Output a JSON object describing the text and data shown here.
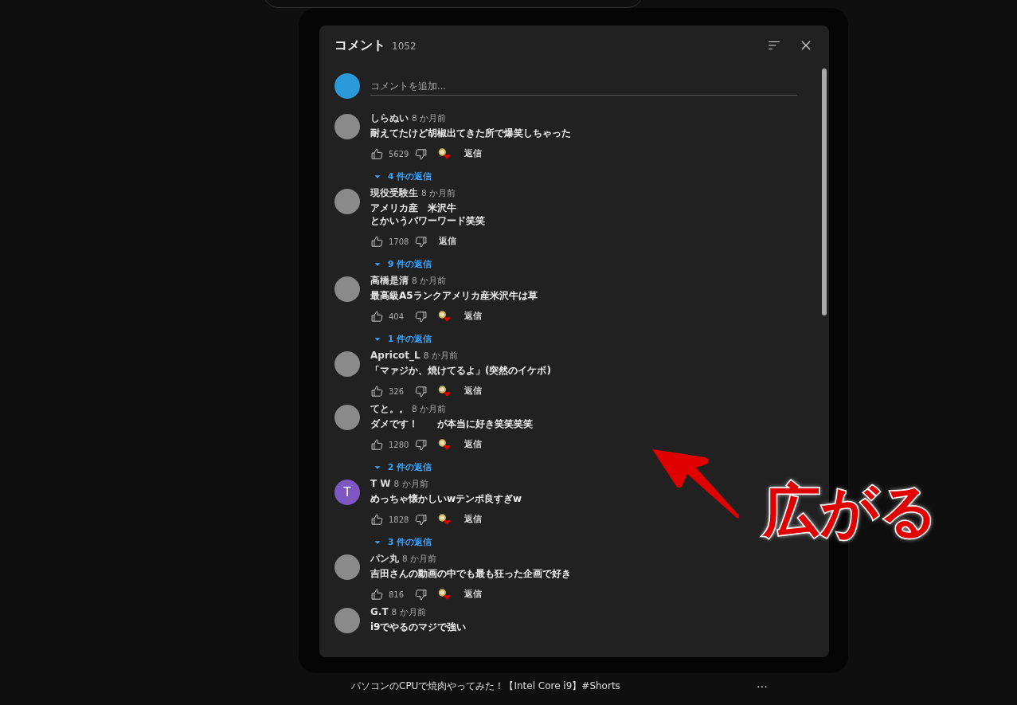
{
  "panel": {
    "title": "コメント",
    "count": "1052",
    "add_comment": {
      "placeholder": "コメントを追加..."
    },
    "comments": [
      {
        "author": "しらぬい",
        "time": "8 か月前",
        "text": [
          "耐えてたけど胡椒出てきた所で爆笑しちゃった"
        ],
        "likes": "5629",
        "hearted": true,
        "reply": "返信",
        "replies": "4 件の返信"
      },
      {
        "author": "現役受験生",
        "time": "8 か月前",
        "text": [
          "アメリカ産　米沢牛",
          "とかいうパワーワード笑笑"
        ],
        "likes": "1708",
        "hearted": false,
        "reply": "返信",
        "replies": "9 件の返信"
      },
      {
        "author": "高橋是清",
        "time": "8 か月前",
        "text": [
          "最高級A5ランクアメリカ産米沢牛は草"
        ],
        "likes": "404",
        "hearted": true,
        "reply": "返信",
        "replies": "1 件の返信"
      },
      {
        "author": "Apricot_L",
        "time": "8 か月前",
        "text": [
          "「マァジか、焼けてるよ」(突然のイケボ)"
        ],
        "likes": "326",
        "hearted": true,
        "reply": "返信"
      },
      {
        "author": "てと。。",
        "time": "8 か月前",
        "text": [
          "ダメです！　　が本当に好き笑笑笑笑"
        ],
        "likes": "1280",
        "hearted": true,
        "reply": "返信",
        "replies": "2 件の返信"
      },
      {
        "author": "T W",
        "time": "8 か月前",
        "avatar": {
          "letter": "T",
          "color": "#7e57c2"
        },
        "text": [
          "めっちゃ懐かしいwテンポ良すぎw"
        ],
        "likes": "1828",
        "hearted": true,
        "reply": "返信",
        "replies": "3 件の返信"
      },
      {
        "author": "パン丸",
        "time": "8 か月前",
        "text": [
          "吉田さんの動画の中でも最も狂った企画で好き"
        ],
        "likes": "816",
        "hearted": true,
        "reply": "返信"
      },
      {
        "author": "G.T",
        "time": "8 か月前",
        "text": [
          "i9でやるのマジで強い"
        ]
      }
    ]
  },
  "video_title": "パソコンのCPUで焼肉やってみた！【Intel Core i9】#Shorts",
  "more": "…",
  "annotation": {
    "text": "広がる"
  }
}
